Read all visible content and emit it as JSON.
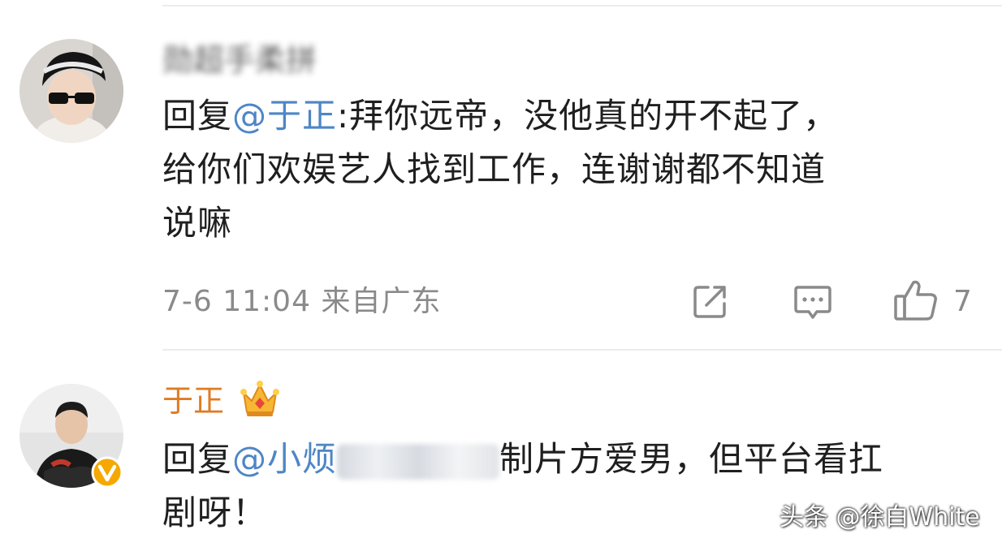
{
  "comments": [
    {
      "username": "勋超手柔拼",
      "reply_prefix": "回复",
      "mention": "@于正",
      "body_line1": ":拜你远帝，没他真的开不起了，",
      "body_line2": "给你们欢娱艺人找到工作，连谢谢都不知道",
      "body_line3": "说嘛",
      "timestamp": "7-6 11:04",
      "location": "来自广东",
      "like_count": "7"
    },
    {
      "username": "于正",
      "reply_prefix": "回复",
      "mention": "@小烦",
      "body_line1_rest": "制片方爱男，但平台看扛",
      "body_line2": "剧呀！"
    }
  ],
  "watermark": "头条 @徐白White",
  "colors": {
    "mention": "#4e86c6",
    "vip_name": "#e07b22",
    "meta_text": "#8a8a8a",
    "verified_badge": "#f5a800"
  },
  "icons": [
    "share-icon",
    "comment-icon",
    "like-icon",
    "crown-icon",
    "verified-badge-icon"
  ]
}
